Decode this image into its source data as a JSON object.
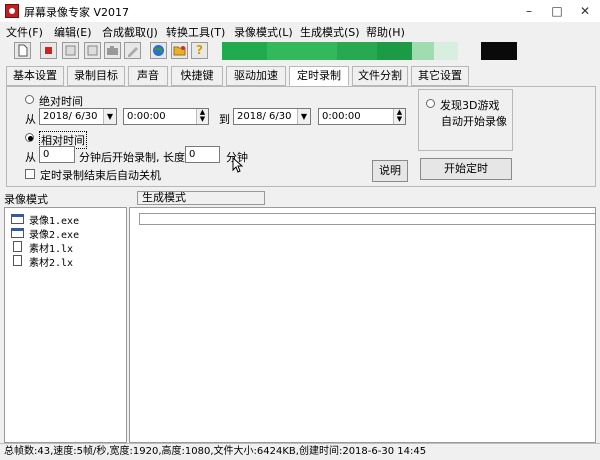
{
  "window": {
    "title": "屏幕录像专家 V2017",
    "minimize": "–",
    "maximize": "□",
    "close": "✕"
  },
  "menu": [
    "文件(F)",
    "编辑(E)",
    "合成截取(J)",
    "转换工具(T)",
    "录像模式(L)",
    "生成模式(S)",
    "帮助(H)"
  ],
  "toolbar": {
    "icons": [
      "new-file-icon",
      "record-icon",
      "window-icon",
      "window-icon",
      "camera-icon",
      "pencil-icon",
      "globe-icon",
      "folder-icon",
      "help-icon"
    ],
    "help_glyph": "?",
    "strip_colors": [
      "#22aa4e",
      "#33b85c",
      "#28a850",
      "#1c9a46",
      "#9fdcb0",
      "#d8efe0"
    ]
  },
  "tabs": [
    "基本设置",
    "录制目标",
    "声音",
    "快捷键",
    "驱动加速",
    "定时录制",
    "文件分割",
    "其它设置"
  ],
  "active_tab": 5,
  "timer": {
    "absolute_label": "绝对时间",
    "from_label": "从",
    "to_label": "到",
    "from_date": "2018/ 6/30",
    "from_time": "0:00:00",
    "to_date": "2018/ 6/30",
    "to_time": "0:00:00",
    "relative_label": "相对时间",
    "rel_from_label": "从",
    "rel_start_value": "0",
    "rel_after_text": "分钟后开始录制, 长度",
    "rel_length_value": "0",
    "rel_unit": "分钟",
    "auto_shutdown_label": "定时录制结束后自动关机",
    "explain_button": "说明",
    "detect_3d_label": "发现3D游戏",
    "auto_record_label": "自动开始录像",
    "start_timer_button": "开始定时"
  },
  "lower": {
    "record_mode_header": "录像模式",
    "generate_mode_tab": "生成模式",
    "files": [
      {
        "name": "录像1.exe",
        "icon": "exe-file-icon"
      },
      {
        "name": "录像2.exe",
        "icon": "exe-file-icon"
      },
      {
        "name": "素材1.lx",
        "icon": "document-icon"
      },
      {
        "name": "素材2.lx",
        "icon": "document-icon"
      }
    ]
  },
  "status": "总帧数:43,速度:5帧/秒,宽度:1920,高度:1080,文件大小:6424KB,创建时间:2018-6-30 14:45"
}
